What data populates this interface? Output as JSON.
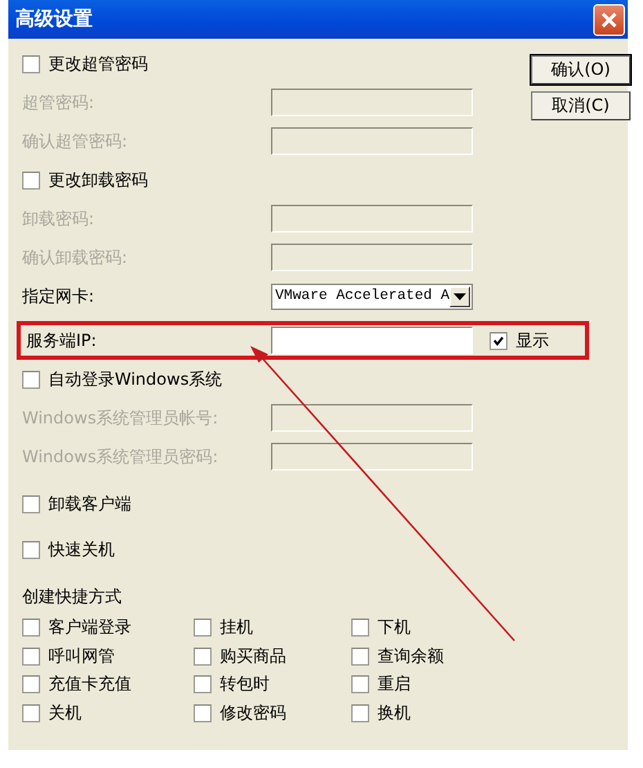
{
  "window": {
    "title": "高级设置"
  },
  "buttons": [
    {
      "label": "确认(O)",
      "default": true
    },
    {
      "label": "取消(C)",
      "default": false
    }
  ],
  "rows": [
    {
      "kind": "checkbox",
      "label": "更改超管密码",
      "checked": false
    },
    {
      "kind": "field",
      "label": "超管密码:",
      "disabled": true
    },
    {
      "kind": "field",
      "label": "确认超管密码:",
      "disabled": true
    },
    {
      "kind": "checkbox",
      "label": "更改卸载密码",
      "checked": false
    },
    {
      "kind": "field",
      "label": "卸载密码:",
      "disabled": true
    },
    {
      "kind": "field",
      "label": "确认卸载密码:",
      "disabled": true
    },
    {
      "kind": "select",
      "label": "指定网卡:",
      "value": "VMware Accelerated A"
    },
    {
      "kind": "field",
      "label": "服务端IP:",
      "disabled": false,
      "highlighted": true,
      "toggle": {
        "label": "显示",
        "checked": true
      }
    },
    {
      "kind": "checkbox",
      "label": "自动登录Windows系统",
      "checked": false
    },
    {
      "kind": "field",
      "label": "Windows系统管理员帐号:",
      "disabled": true
    },
    {
      "kind": "field",
      "label": "Windows系统管理员密码:",
      "disabled": true
    },
    {
      "kind": "checkbox",
      "label": "卸载客户端",
      "checked": false
    },
    {
      "kind": "checkbox",
      "label": "快速关机",
      "checked": false
    }
  ],
  "shortcuts": {
    "title": "创建快捷方式",
    "items": [
      {
        "label": "客户端登录",
        "checked": false
      },
      {
        "label": "挂机",
        "checked": false
      },
      {
        "label": "下机",
        "checked": false
      },
      {
        "label": "呼叫网管",
        "checked": false
      },
      {
        "label": "购买商品",
        "checked": false
      },
      {
        "label": "查询余额",
        "checked": false
      },
      {
        "label": "充值卡充值",
        "checked": false
      },
      {
        "label": "转包时",
        "checked": false
      },
      {
        "label": "重启",
        "checked": false
      },
      {
        "label": "关机",
        "checked": false
      },
      {
        "label": "修改密码",
        "checked": false
      },
      {
        "label": "换机",
        "checked": false
      }
    ]
  }
}
